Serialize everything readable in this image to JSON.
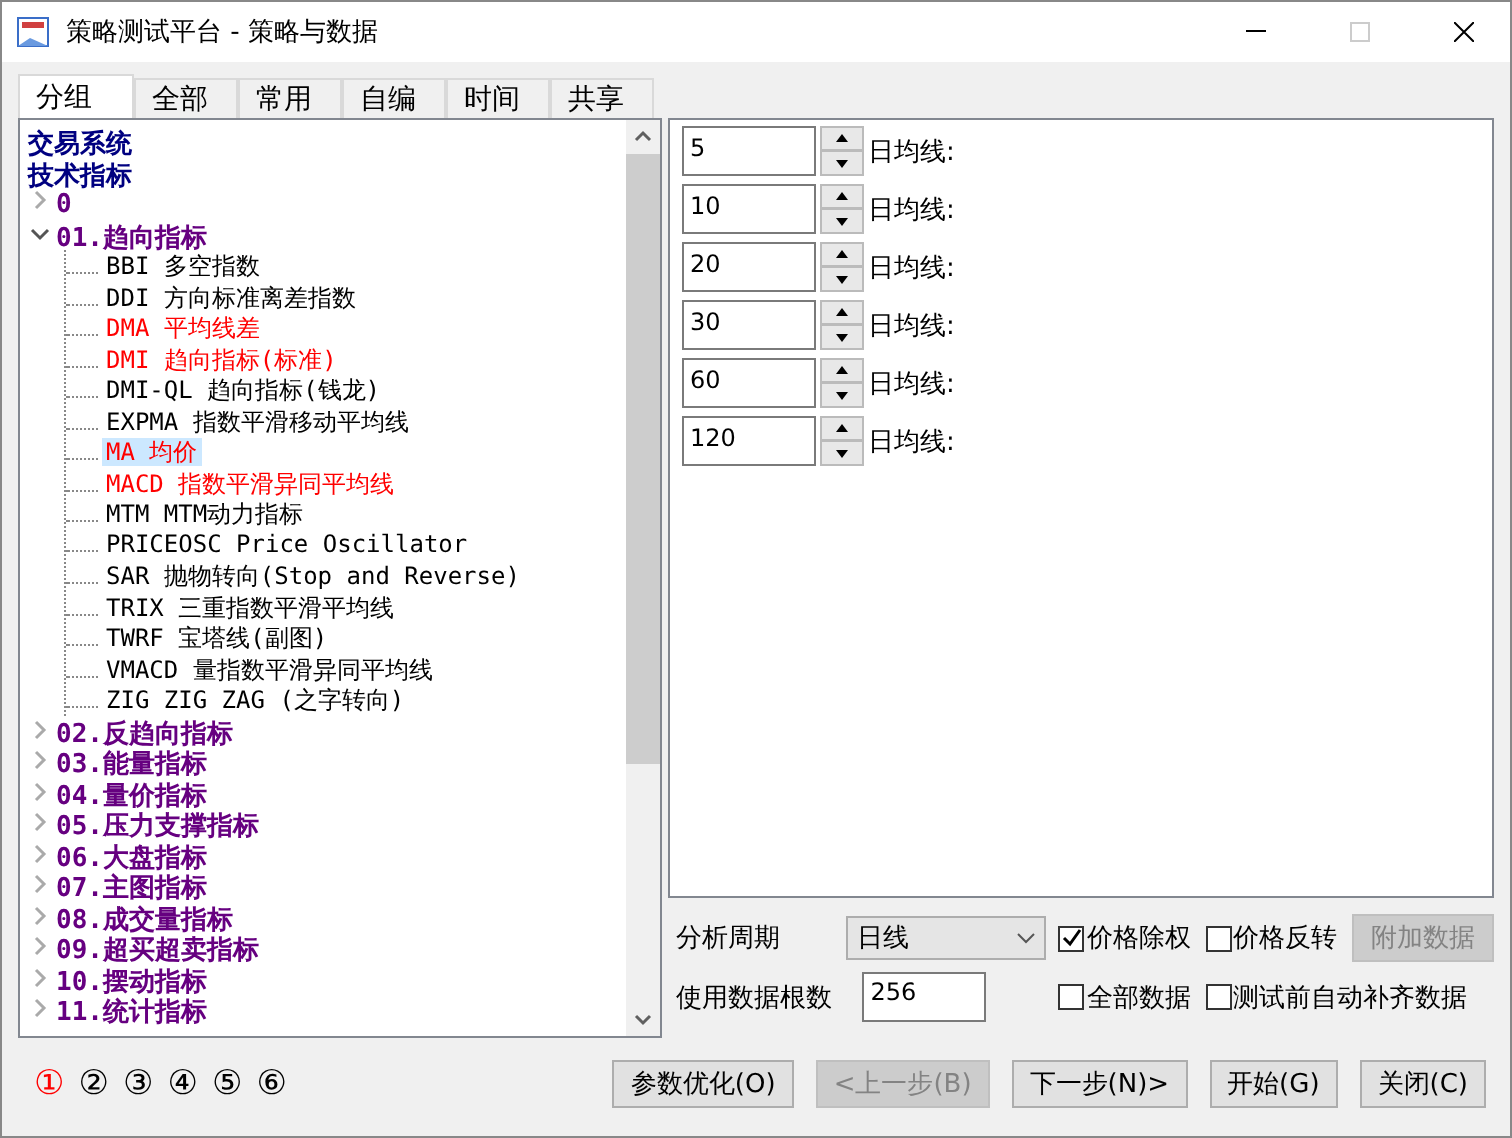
{
  "window": {
    "title": "策略测试平台 - 策略与数据"
  },
  "tabs": [
    {
      "label": "分组",
      "selected": true
    },
    {
      "label": "全部",
      "selected": false
    },
    {
      "label": "常用",
      "selected": false
    },
    {
      "label": "自编",
      "selected": false
    },
    {
      "label": "时间",
      "selected": false
    },
    {
      "label": "共享",
      "selected": false
    }
  ],
  "tree": [
    {
      "kind": "root",
      "label": "交易系统"
    },
    {
      "kind": "root",
      "label": "技术指标"
    },
    {
      "kind": "group",
      "label": "0",
      "expanded": false
    },
    {
      "kind": "group",
      "label": "01.趋向指标",
      "expanded": true,
      "children": [
        {
          "label": "BBI 多空指数",
          "color": "#000000",
          "selected": false
        },
        {
          "label": "DDI 方向标准离差指数",
          "color": "#000000",
          "selected": false
        },
        {
          "label": "DMA 平均线差",
          "color": "#ff0000",
          "selected": false
        },
        {
          "label": "DMI 趋向指标(标准)",
          "color": "#ff0000",
          "selected": false
        },
        {
          "label": "DMI-QL 趋向指标(钱龙)",
          "color": "#000000",
          "selected": false
        },
        {
          "label": "EXPMA 指数平滑移动平均线",
          "color": "#000000",
          "selected": false
        },
        {
          "label": "MA 均价",
          "color": "#ff0000",
          "selected": true
        },
        {
          "label": "MACD 指数平滑异同平均线",
          "color": "#ff0000",
          "selected": false
        },
        {
          "label": "MTM MTM动力指标",
          "color": "#000000",
          "selected": false
        },
        {
          "label": "PRICEOSC Price Oscillator",
          "color": "#000000",
          "selected": false
        },
        {
          "label": "SAR 抛物转向(Stop and Reverse)",
          "color": "#000000",
          "selected": false
        },
        {
          "label": "TRIX 三重指数平滑平均线",
          "color": "#000000",
          "selected": false
        },
        {
          "label": "TWRF 宝塔线(副图)",
          "color": "#000000",
          "selected": false
        },
        {
          "label": "VMACD 量指数平滑异同平均线",
          "color": "#000000",
          "selected": false
        },
        {
          "label": "ZIG ZIG ZAG (之字转向)",
          "color": "#000000",
          "selected": false
        }
      ]
    },
    {
      "kind": "group",
      "label": "02.反趋向指标",
      "expanded": false
    },
    {
      "kind": "group",
      "label": "03.能量指标",
      "expanded": false
    },
    {
      "kind": "group",
      "label": "04.量价指标",
      "expanded": false
    },
    {
      "kind": "group",
      "label": "05.压力支撑指标",
      "expanded": false
    },
    {
      "kind": "group",
      "label": "06.大盘指标",
      "expanded": false
    },
    {
      "kind": "group",
      "label": "07.主图指标",
      "expanded": false
    },
    {
      "kind": "group",
      "label": "08.成交量指标",
      "expanded": false
    },
    {
      "kind": "group",
      "label": "09.超买超卖指标",
      "expanded": false
    },
    {
      "kind": "group",
      "label": "10.摆动指标",
      "expanded": false
    },
    {
      "kind": "group",
      "label": "11.统计指标",
      "expanded": false
    }
  ],
  "params": [
    {
      "value": "5",
      "label": "日均线:"
    },
    {
      "value": "10",
      "label": "日均线:"
    },
    {
      "value": "20",
      "label": "日均线:"
    },
    {
      "value": "30",
      "label": "日均线:"
    },
    {
      "value": "60",
      "label": "日均线:"
    },
    {
      "value": "120",
      "label": "日均线:"
    }
  ],
  "options": {
    "period_label": "分析周期",
    "period": "日线",
    "adjust": {
      "label": "价格除权",
      "checked": true
    },
    "reverse": {
      "label": "价格反转",
      "checked": false
    },
    "extra_button": {
      "label": "附加数据",
      "disabled": true
    },
    "count_label": "使用数据根数",
    "count": "256",
    "all_data": {
      "label": "全部数据",
      "checked": false
    },
    "auto_fill": {
      "label": "测试前自动补齐数据",
      "checked": false
    }
  },
  "steps": [
    {
      "label": "①",
      "selected": true
    },
    {
      "label": "②",
      "selected": false
    },
    {
      "label": "③",
      "selected": false
    },
    {
      "label": "④",
      "selected": false
    },
    {
      "label": "⑤",
      "selected": false
    },
    {
      "label": "⑥",
      "selected": false
    }
  ],
  "buttons": [
    {
      "label": "参数优化(O)",
      "disabled": false
    },
    {
      "label": "<上一步(B)",
      "disabled": true
    },
    {
      "label": "下一步(N)>",
      "disabled": false
    },
    {
      "label": "开始(G)",
      "disabled": false
    },
    {
      "label": "关闭(C)",
      "disabled": false
    }
  ]
}
